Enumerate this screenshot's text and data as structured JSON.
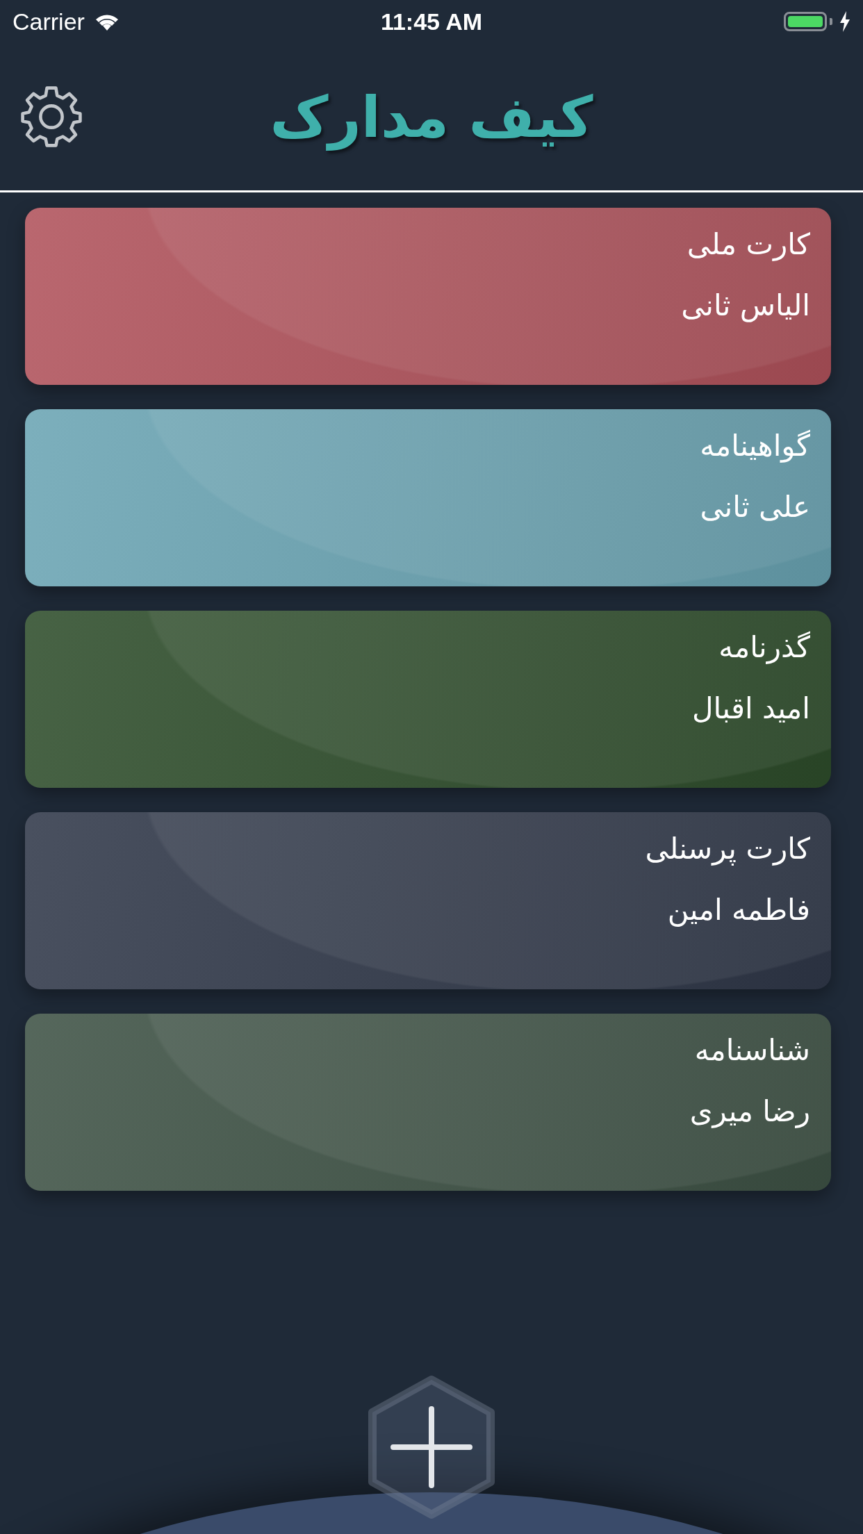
{
  "status_bar": {
    "carrier": "Carrier",
    "time": "11:45 AM",
    "charging": true,
    "battery": {
      "level": 1
    }
  },
  "header": {
    "logo": "کیف مدارک"
  },
  "cards": [
    {
      "title": "کارت ملی",
      "name": "الیاس ثانی",
      "color": "#b0525b"
    },
    {
      "title": "گواهینامه",
      "name": "علی ثانی",
      "color": "#6aa4b3"
    },
    {
      "title": "گذرنامه",
      "name": "امید اقبال",
      "color": "#2e4d2b"
    },
    {
      "title": "کارت پرسنلی",
      "name": "فاطمه امین",
      "color": "#303849"
    },
    {
      "title": "شناسنامه",
      "name": "رضا میری",
      "color": "#3e5245"
    }
  ]
}
